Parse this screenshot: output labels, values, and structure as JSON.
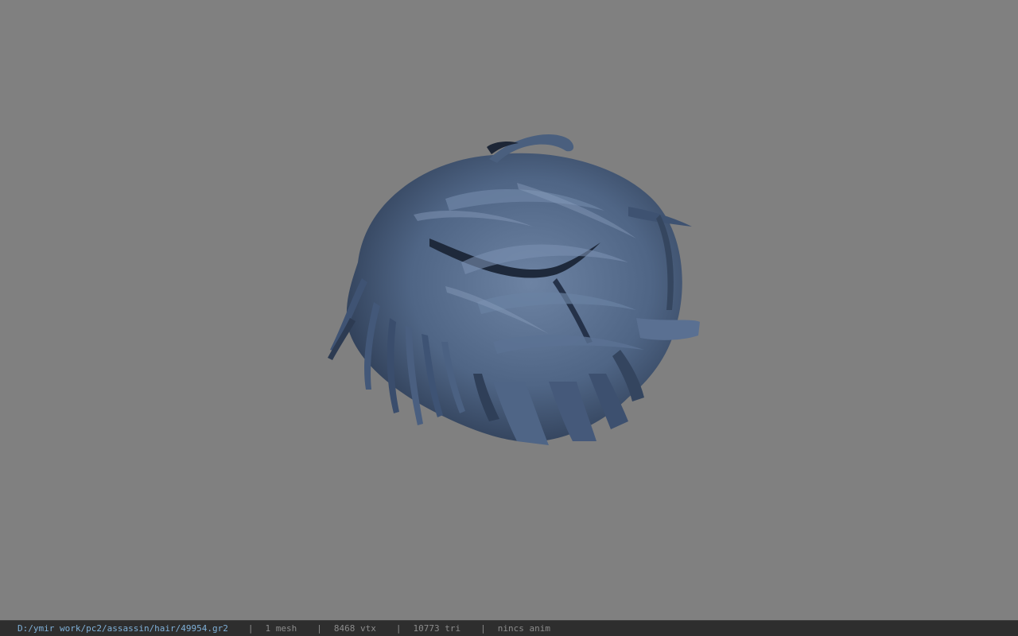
{
  "viewport": {
    "background_color": "#808080",
    "model_color": "#4b607f",
    "model_dark_color": "#1f2a3c",
    "model_light_color": "#7a90b0",
    "model_icon": "hair-mesh"
  },
  "status_bar": {
    "file_path": "D:/ymir work/pc2/assassin/hair/49954.gr2",
    "separator": "|",
    "mesh_count": "1 mesh",
    "vertex_count": "8468 vtx",
    "triangle_count": "10773 tri",
    "animation": "nincs anim"
  }
}
